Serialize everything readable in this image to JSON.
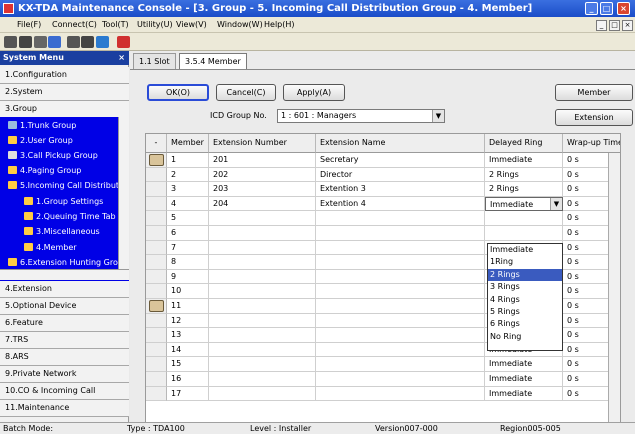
{
  "title": "KX-TDA Maintenance Console - [3. Group - 5. Incoming Call Distribution Group - 4. Member]",
  "window_buttons": [
    "_",
    "□",
    "×"
  ],
  "menu": [
    "File(F)",
    "Connect(C)",
    "Tool(T)",
    "Utility(U)",
    "View(V)",
    "Window(W)",
    "Help(H)"
  ],
  "mdi_buttons": [
    "_",
    "□",
    "×"
  ],
  "sidebar": {
    "title": "System Menu",
    "close": "×",
    "sections_top": [
      "1.Configuration",
      "2.System",
      "3.Group"
    ],
    "tree": [
      {
        "label": "1.Trunk Group",
        "icon": "trunk-group-icon"
      },
      {
        "label": "2.User Group",
        "icon": "user-group-icon"
      },
      {
        "label": "3.Call Pickup Group",
        "icon": "call-pickup-icon"
      },
      {
        "label": "4.Paging Group",
        "icon": "paging-icon"
      },
      {
        "label": "5.Incoming Call Distribut",
        "icon": "icd-group-icon"
      },
      {
        "label": "1.Group Settings",
        "icon": "group-settings-icon"
      },
      {
        "label": "2.Queuing Time Tab",
        "icon": "queuing-icon"
      },
      {
        "label": "3.Miscellaneous",
        "icon": "misc-icon"
      },
      {
        "label": "4.Member",
        "icon": "member-icon"
      },
      {
        "label": "6.Extension Hunting Gro",
        "icon": "hunting-icon"
      }
    ],
    "sections_bottom": [
      "4.Extension",
      "5.Optional Device",
      "6.Feature",
      "7.TRS",
      "8.ARS",
      "9.Private Network",
      "10.CO & Incoming Call",
      "11.Maintenance"
    ]
  },
  "tabs": [
    "1.1 Slot",
    "3.5.4 Member"
  ],
  "buttons": {
    "ok": "OK(O)",
    "cancel": "Cancel(C)",
    "apply": "Apply(A)",
    "member": "Member",
    "extension": "Extension"
  },
  "icd": {
    "label": "ICD Group No.",
    "value": "1 : 601 : Managers"
  },
  "table": {
    "corner": "-",
    "headers": [
      "Member",
      "Extension Number",
      "Extension Name",
      "Delayed Ring",
      "Wrap-up Time"
    ],
    "rows": [
      {
        "member": "1",
        "ext": "201",
        "name": "Secretary",
        "ring": "Immediate",
        "wrap": "0 s"
      },
      {
        "member": "2",
        "ext": "202",
        "name": "Director",
        "ring": "2 Rings",
        "wrap": "0 s"
      },
      {
        "member": "3",
        "ext": "203",
        "name": "Extention 3",
        "ring": "2 Rings",
        "wrap": "0 s"
      },
      {
        "member": "4",
        "ext": "204",
        "name": "Extention 4",
        "ring": "Immediate",
        "wrap": "0 s"
      },
      {
        "member": "5",
        "ext": "",
        "name": "",
        "ring": "",
        "wrap": "0 s"
      },
      {
        "member": "6",
        "ext": "",
        "name": "",
        "ring": "",
        "wrap": "0 s"
      },
      {
        "member": "7",
        "ext": "",
        "name": "",
        "ring": "",
        "wrap": "0 s"
      },
      {
        "member": "8",
        "ext": "",
        "name": "",
        "ring": "",
        "wrap": "0 s"
      },
      {
        "member": "9",
        "ext": "",
        "name": "",
        "ring": "",
        "wrap": "0 s"
      },
      {
        "member": "10",
        "ext": "",
        "name": "",
        "ring": "",
        "wrap": "0 s"
      },
      {
        "member": "11",
        "ext": "",
        "name": "",
        "ring": "Immediate",
        "wrap": "0 s"
      },
      {
        "member": "12",
        "ext": "",
        "name": "",
        "ring": "Immediate",
        "wrap": "0 s"
      },
      {
        "member": "13",
        "ext": "",
        "name": "",
        "ring": "Immediate",
        "wrap": "0 s"
      },
      {
        "member": "14",
        "ext": "",
        "name": "",
        "ring": "Immediate",
        "wrap": "0 s"
      },
      {
        "member": "15",
        "ext": "",
        "name": "",
        "ring": "Immediate",
        "wrap": "0 s"
      },
      {
        "member": "16",
        "ext": "",
        "name": "",
        "ring": "Immediate",
        "wrap": "0 s"
      },
      {
        "member": "17",
        "ext": "",
        "name": "",
        "ring": "Immediate",
        "wrap": "0 s"
      }
    ]
  },
  "dropdown": {
    "options": [
      "Immediate",
      "1Ring",
      "2 Rings",
      "3 Rings",
      "4 Rings",
      "5 Rings",
      "6 Rings",
      "No Ring"
    ],
    "selected": "2 Rings"
  },
  "status": {
    "batch": "Batch Mode:",
    "type": "Type : TDA100",
    "level": "Level : Installer",
    "version": "Version007-000",
    "region": "Region005-005"
  }
}
